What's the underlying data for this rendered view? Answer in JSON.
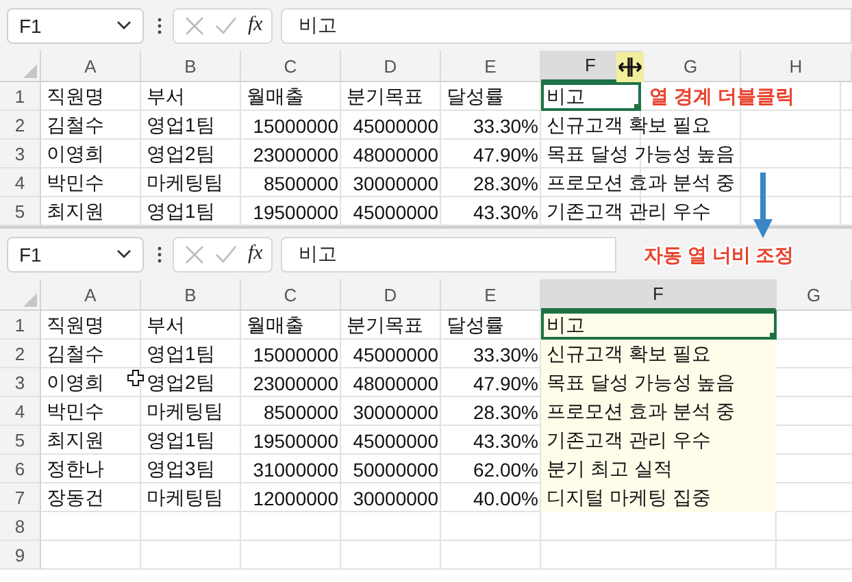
{
  "panels": [
    {
      "name_box": "F1",
      "formula_label": "fx",
      "formula": "비고",
      "annotation": "열 경계 더블클릭",
      "columns": [
        {
          "label": "A",
          "kind": "normal",
          "selected": false,
          "highlighted": false
        },
        {
          "label": "B",
          "kind": "normal",
          "selected": false,
          "highlighted": false
        },
        {
          "label": "C",
          "kind": "normal",
          "selected": false,
          "highlighted": false
        },
        {
          "label": "D",
          "kind": "normal",
          "selected": false,
          "highlighted": false
        },
        {
          "label": "E",
          "kind": "normal",
          "selected": false,
          "highlighted": false
        },
        {
          "label": "F",
          "kind": "normal",
          "selected": true,
          "highlighted": false
        },
        {
          "label": "G",
          "kind": "normal",
          "selected": false,
          "highlighted": false
        },
        {
          "label": "H",
          "kind": "normal",
          "selected": false,
          "highlighted": false
        }
      ],
      "rows": [
        {
          "number": "1",
          "cells": [
            {
              "text": "직원명",
              "kind": "text",
              "selected": false
            },
            {
              "text": "부서",
              "kind": "text",
              "selected": false
            },
            {
              "text": "월매출",
              "kind": "text",
              "selected": false
            },
            {
              "text": "분기목표",
              "kind": "text",
              "selected": false
            },
            {
              "text": "달성률",
              "kind": "text",
              "selected": false
            },
            {
              "text": "비고",
              "kind": "text",
              "selected": true
            }
          ]
        },
        {
          "number": "2",
          "cells": [
            {
              "text": "김철수",
              "kind": "text",
              "selected": false
            },
            {
              "text": "영업1팀",
              "kind": "text",
              "selected": false
            },
            {
              "text": "15000000",
              "kind": "number",
              "selected": false
            },
            {
              "text": "45000000",
              "kind": "number",
              "selected": false
            },
            {
              "text": "33.30%",
              "kind": "number",
              "selected": false
            },
            {
              "text": "신규고객 확보 필요",
              "kind": "text",
              "selected": false
            }
          ]
        },
        {
          "number": "3",
          "cells": [
            {
              "text": "이영희",
              "kind": "text",
              "selected": false
            },
            {
              "text": "영업2팀",
              "kind": "text",
              "selected": false
            },
            {
              "text": "23000000",
              "kind": "number",
              "selected": false
            },
            {
              "text": "48000000",
              "kind": "number",
              "selected": false
            },
            {
              "text": "47.90%",
              "kind": "number",
              "selected": false
            },
            {
              "text": "목표 달성 가능성 높음",
              "kind": "text",
              "selected": false
            }
          ]
        },
        {
          "number": "4",
          "cells": [
            {
              "text": "박민수",
              "kind": "text",
              "selected": false
            },
            {
              "text": "마케팅팀",
              "kind": "text",
              "selected": false
            },
            {
              "text": "8500000",
              "kind": "number",
              "selected": false
            },
            {
              "text": "30000000",
              "kind": "number",
              "selected": false
            },
            {
              "text": "28.30%",
              "kind": "number",
              "selected": false
            },
            {
              "text": "프로모션 효과 분석 중",
              "kind": "text",
              "selected": false
            }
          ]
        },
        {
          "number": "5",
          "cells": [
            {
              "text": "최지원",
              "kind": "text",
              "selected": false
            },
            {
              "text": "영업1팀",
              "kind": "text",
              "selected": false
            },
            {
              "text": "19500000",
              "kind": "number",
              "selected": false
            },
            {
              "text": "45000000",
              "kind": "number",
              "selected": false
            },
            {
              "text": "43.30%",
              "kind": "number",
              "selected": false
            },
            {
              "text": "기존고객 관리 우수",
              "kind": "text",
              "selected": false
            }
          ]
        }
      ]
    },
    {
      "name_box": "F1",
      "formula_label": "fx",
      "formula": "비고",
      "annotation": "자동 열 너비 조정",
      "columns": [
        {
          "label": "A",
          "kind": "normal",
          "selected": false,
          "highlighted": false
        },
        {
          "label": "B",
          "kind": "normal",
          "selected": false,
          "highlighted": false
        },
        {
          "label": "C",
          "kind": "normal",
          "selected": false,
          "highlighted": false
        },
        {
          "label": "D",
          "kind": "normal",
          "selected": false,
          "highlighted": false
        },
        {
          "label": "E",
          "kind": "normal",
          "selected": false,
          "highlighted": false
        },
        {
          "label": "F",
          "kind": "wide",
          "selected": true,
          "highlighted": true
        },
        {
          "label": "G",
          "kind": "normal",
          "selected": false,
          "highlighted": false
        }
      ],
      "rows": [
        {
          "number": "1",
          "cells": [
            {
              "text": "직원명",
              "kind": "text",
              "selected": false
            },
            {
              "text": "부서",
              "kind": "text",
              "selected": false
            },
            {
              "text": "월매출",
              "kind": "text",
              "selected": false
            },
            {
              "text": "분기목표",
              "kind": "text",
              "selected": false
            },
            {
              "text": "달성률",
              "kind": "text",
              "selected": false
            },
            {
              "text": "비고",
              "kind": "text",
              "selected": true
            }
          ]
        },
        {
          "number": "2",
          "cells": [
            {
              "text": "김철수",
              "kind": "text",
              "selected": false
            },
            {
              "text": "영업1팀",
              "kind": "text",
              "selected": false
            },
            {
              "text": "15000000",
              "kind": "number",
              "selected": false
            },
            {
              "text": "45000000",
              "kind": "number",
              "selected": false
            },
            {
              "text": "33.30%",
              "kind": "number",
              "selected": false
            },
            {
              "text": "신규고객 확보 필요",
              "kind": "text",
              "selected": false
            }
          ]
        },
        {
          "number": "3",
          "cells": [
            {
              "text": "이영희",
              "kind": "text",
              "selected": false
            },
            {
              "text": "영업2팀",
              "kind": "text",
              "selected": false
            },
            {
              "text": "23000000",
              "kind": "number",
              "selected": false
            },
            {
              "text": "48000000",
              "kind": "number",
              "selected": false
            },
            {
              "text": "47.90%",
              "kind": "number",
              "selected": false
            },
            {
              "text": "목표 달성 가능성 높음",
              "kind": "text",
              "selected": false
            }
          ]
        },
        {
          "number": "4",
          "cells": [
            {
              "text": "박민수",
              "kind": "text",
              "selected": false
            },
            {
              "text": "마케팅팀",
              "kind": "text",
              "selected": false
            },
            {
              "text": "8500000",
              "kind": "number",
              "selected": false
            },
            {
              "text": "30000000",
              "kind": "number",
              "selected": false
            },
            {
              "text": "28.30%",
              "kind": "number",
              "selected": false
            },
            {
              "text": "프로모션 효과 분석 중",
              "kind": "text",
              "selected": false
            }
          ]
        },
        {
          "number": "5",
          "cells": [
            {
              "text": "최지원",
              "kind": "text",
              "selected": false
            },
            {
              "text": "영업1팀",
              "kind": "text",
              "selected": false
            },
            {
              "text": "19500000",
              "kind": "number",
              "selected": false
            },
            {
              "text": "45000000",
              "kind": "number",
              "selected": false
            },
            {
              "text": "43.30%",
              "kind": "number",
              "selected": false
            },
            {
              "text": "기존고객 관리 우수",
              "kind": "text",
              "selected": false
            }
          ]
        },
        {
          "number": "6",
          "cells": [
            {
              "text": "정한나",
              "kind": "text",
              "selected": false
            },
            {
              "text": "영업3팀",
              "kind": "text",
              "selected": false
            },
            {
              "text": "31000000",
              "kind": "number",
              "selected": false
            },
            {
              "text": "50000000",
              "kind": "number",
              "selected": false
            },
            {
              "text": "62.00%",
              "kind": "number",
              "selected": false
            },
            {
              "text": "분기 최고 실적",
              "kind": "text",
              "selected": false
            }
          ]
        },
        {
          "number": "7",
          "cells": [
            {
              "text": "장동건",
              "kind": "text",
              "selected": false
            },
            {
              "text": "마케팅팀",
              "kind": "text",
              "selected": false
            },
            {
              "text": "12000000",
              "kind": "number",
              "selected": false
            },
            {
              "text": "30000000",
              "kind": "number",
              "selected": false
            },
            {
              "text": "40.00%",
              "kind": "number",
              "selected": false
            },
            {
              "text": "디지털 마케팅 집중",
              "kind": "text",
              "selected": false
            }
          ]
        },
        {
          "number": "8",
          "cells": []
        },
        {
          "number": "9",
          "cells": []
        }
      ]
    }
  ]
}
